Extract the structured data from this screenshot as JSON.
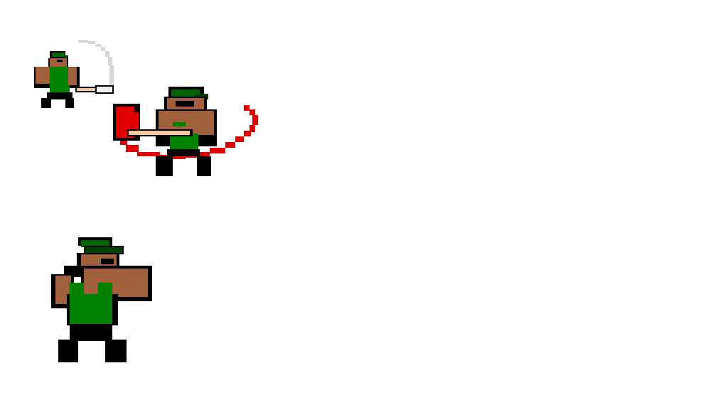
{
  "scene": {
    "background": "#ffffff"
  },
  "palette": {
    "outline": "#000000",
    "skin": "#a0603c",
    "skin_shadow": "#7a4528",
    "shirt": "#008000",
    "shirt_dark": "#006400",
    "cap": "#006400",
    "cap_dark": "#004000",
    "handle": "#f4c89a",
    "axe_red": "#e00000",
    "slash_red": "#e00000",
    "slash_gray": "#d8d8d8",
    "blade_gray": "#f0f0f0"
  },
  "sprites": [
    {
      "id": "lumberjack-small-swing",
      "icon": "lumberjack-small-swing-sprite",
      "pose": "small-swing"
    },
    {
      "id": "lumberjack-axe-spin",
      "icon": "lumberjack-axe-spin-sprite",
      "pose": "axe-spin"
    },
    {
      "id": "lumberjack-idle-large",
      "icon": "lumberjack-idle-large-sprite",
      "pose": "idle-large"
    }
  ]
}
